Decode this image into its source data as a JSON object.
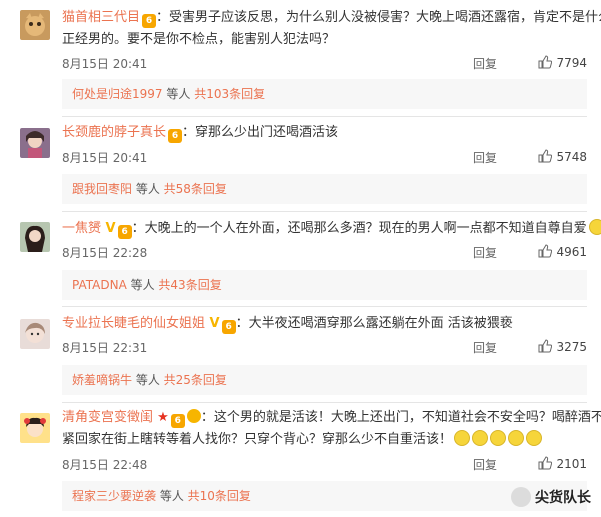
{
  "comments": [
    {
      "username": "猫首相三代目",
      "text_line1": "：受害男子应该反思，为什么别人没被侵害？大晚上喝酒还露宿，肯定不是什么",
      "text_line2": "正经男的。要不是你不检点，能害别人犯法吗？",
      "date": "8月15日 20:41",
      "reply_label": "回复",
      "likes": "7794",
      "reply_user": "何处是归途1997",
      "reply_mid": " 等人 ",
      "reply_count": "共103条回复"
    },
    {
      "username": "长颈鹿的脖子真长",
      "text_line1": "：穿那么少出门还喝酒活该",
      "date": "8月15日 20:41",
      "reply_label": "回复",
      "likes": "5748",
      "reply_user": "跟我回枣阳",
      "reply_mid": " 等人 ",
      "reply_count": "共58条回复"
    },
    {
      "username": "一焦赟",
      "text_line1": "：大晚上的一个人在外面，还喝那么多酒？现在的男人啊一点都不知道自尊自爱",
      "date": "8月15日 22:28",
      "reply_label": "回复",
      "likes": "4961",
      "reply_user": "PATADNA",
      "reply_mid": " 等人 ",
      "reply_count": "共43条回复"
    },
    {
      "username": "专业拉长睫毛的仙女姐姐",
      "text_line1": "：大半夜还喝酒穿那么露还躺在外面 活该被猥亵",
      "date": "8月15日 22:31",
      "reply_label": "回复",
      "likes": "3275",
      "reply_user": "娇羞嘀锅牛",
      "reply_mid": " 等人 ",
      "reply_count": "共25条回复"
    },
    {
      "username": "清角变宫变徵闺",
      "text_line1": "：这个男的就是活该！大晚上还出门，不知道社会不安全吗？喝醉酒不赶",
      "text_line2": "紧回家在街上瞎转等着人找你？只穿个背心？穿那么少不自重活该！",
      "date": "8月15日 22:48",
      "reply_label": "回复",
      "likes": "2101",
      "reply_user": "程家三少要逆袭",
      "reply_mid": " 等人 ",
      "reply_count": "共10条回复"
    }
  ],
  "watermark": "尖货队长",
  "colors": {
    "username": "#eb7350",
    "divider": "#e5e5e5",
    "reply_bg": "#f7f7f7"
  }
}
